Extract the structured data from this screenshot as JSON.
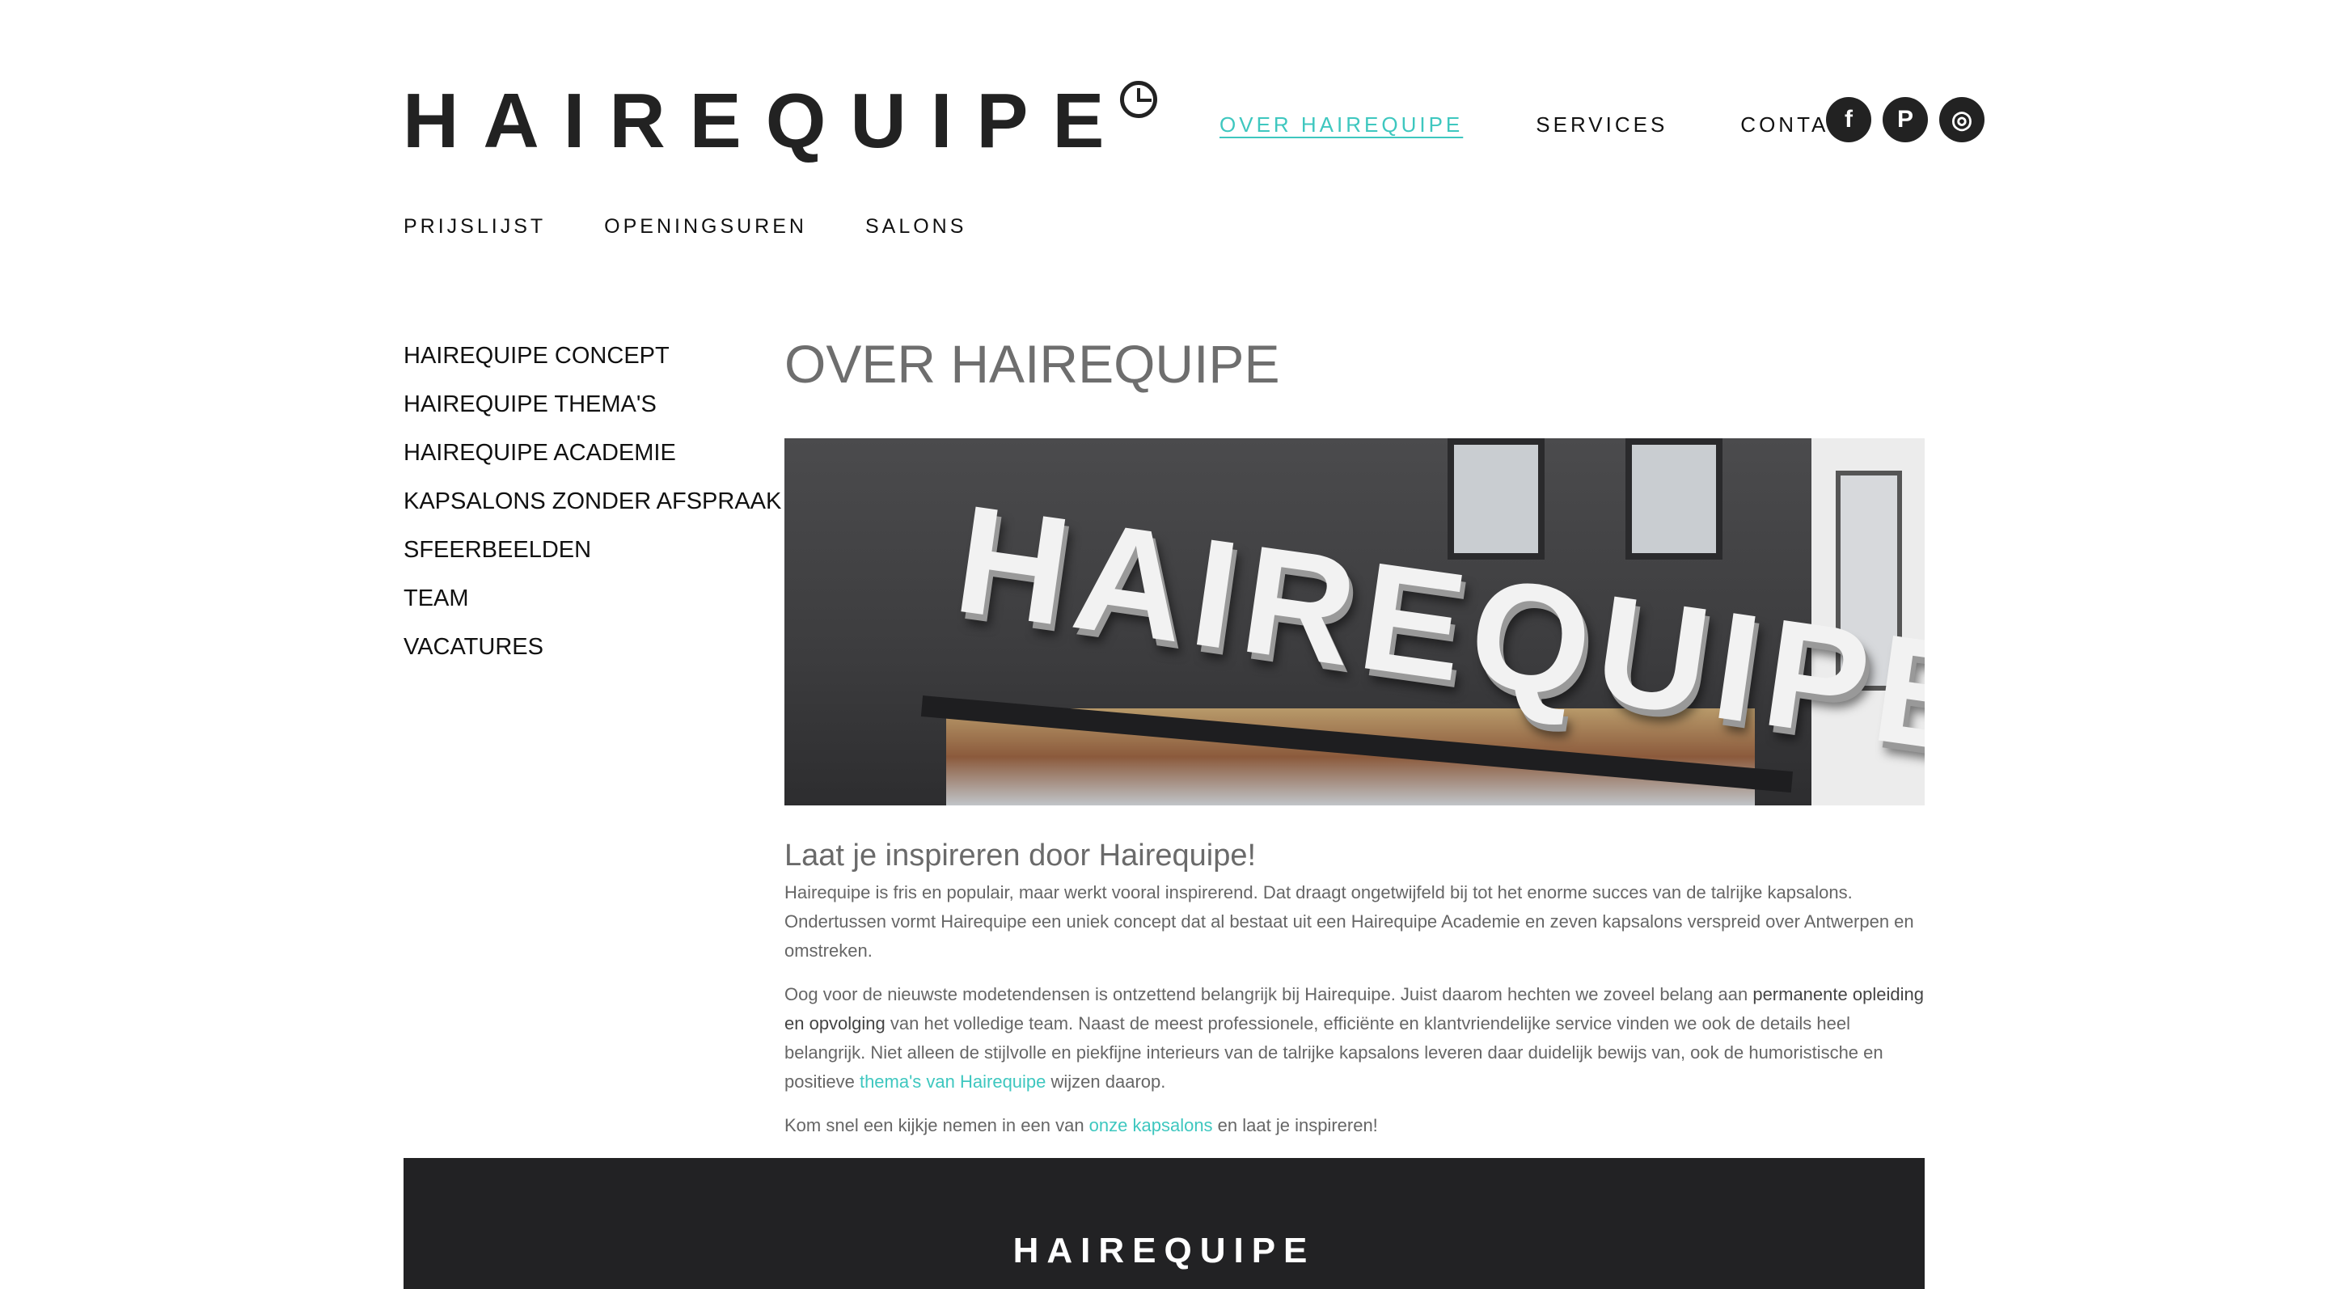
{
  "header": {
    "logo_text": "HAIREQUIPE",
    "nav": [
      {
        "label": "OVER HAIREQUIPE",
        "active": true
      },
      {
        "label": "SERVICES",
        "active": false
      },
      {
        "label": "CONTACT",
        "active": false
      }
    ],
    "social": [
      {
        "icon": "facebook-icon",
        "glyph": "f"
      },
      {
        "icon": "pinterest-icon",
        "glyph": "P"
      },
      {
        "icon": "instagram-icon",
        "glyph": "◎"
      }
    ],
    "subnav": [
      "PRIJSLIJST",
      "OPENINGSUREN",
      "SALONS"
    ]
  },
  "sidebar": {
    "items": [
      "HAIREQUIPE CONCEPT",
      "HAIREQUIPE THEMA'S",
      "HAIREQUIPE ACADEMIE",
      "KAPSALONS ZONDER AFSPRAAK",
      "SFEERBEELDEN",
      "TEAM",
      "VACATURES"
    ]
  },
  "main": {
    "title": "OVER HAIREQUIPE",
    "hero_sign_text": "HAIREQUIPE",
    "intro_heading": "Laat je inspireren door Hairequipe!",
    "paragraph1": "Hairequipe is fris en populair, maar werkt vooral inspirerend. Dat draagt ongetwijfeld bij tot het enorme succes van de talrijke kapsalons. Ondertussen vormt Hairequipe een uniek concept dat al bestaat uit een Hairequipe Academie en zeven kapsalons verspreid over Antwerpen en omstreken.",
    "paragraph2": {
      "part1": "Oog voor de nieuwste modetendensen is ontzettend belangrijk bij Hairequipe. Juist daarom hechten we zoveel belang aan ",
      "strong": "permanente opleiding en opvolging",
      "part2": " van het volledige team. Naast de meest professionele, efficiënte en klantvriendelijke service vinden we ook de details heel belangrijk. Niet alleen de stijlvolle en piekfijne interieurs van de talrijke kapsalons leveren daar duidelijk bewijs van, ook de humoristische en positieve ",
      "link": "thema's van Hairequipe",
      "part3": " wijzen daarop."
    },
    "paragraph3": {
      "part1": "Kom snel een kijkje nemen in een van ",
      "link": "onze kapsalons",
      "part2": " en laat je inspireren!"
    }
  },
  "footer": {
    "logo_text": "HAIREQUIPE"
  },
  "colors": {
    "accent": "#3ec7bf",
    "heading_gray": "#6e6e6e",
    "footer_bg": "#222224"
  }
}
